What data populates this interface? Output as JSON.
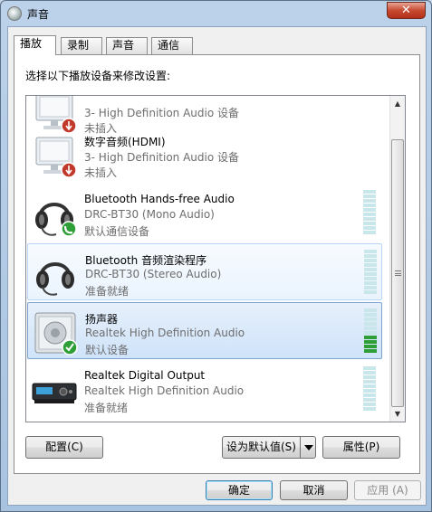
{
  "window": {
    "title": "声音",
    "close_glyph": "✕"
  },
  "tabs": [
    {
      "label": "播放",
      "active": true
    },
    {
      "label": "录制",
      "active": false
    },
    {
      "label": "声音",
      "active": false
    },
    {
      "label": "通信",
      "active": false
    }
  ],
  "instruction": "选择以下播放设备来修改设置:",
  "devices": [
    {
      "icon": "monitor-icon",
      "badge": "unplugged-badge-icon",
      "name": "",
      "desc": "3- High Definition Audio 设备",
      "status": "未插入",
      "level": null
    },
    {
      "icon": "monitor-icon",
      "badge": "unplugged-badge-icon",
      "name": "数字音频(HDMI)",
      "desc": "3- High Definition Audio 设备",
      "status": "未插入",
      "level": null
    },
    {
      "icon": "headset-icon",
      "badge": "phone-badge-icon",
      "name": "Bluetooth Hands-free Audio",
      "desc": "DRC-BT30 (Mono Audio)",
      "status": "默认通信设备",
      "level": 0
    },
    {
      "icon": "headset-icon",
      "badge": "",
      "name": "Bluetooth 音频渲染程序",
      "desc": "DRC-BT30 (Stereo Audio)",
      "status": "准备就绪",
      "level": 0
    },
    {
      "icon": "speaker-icon",
      "badge": "default-check-badge-icon",
      "name": "扬声器",
      "desc": "Realtek High Definition Audio",
      "status": "默认设备",
      "level": 0.4
    },
    {
      "icon": "digital-output-icon",
      "badge": "",
      "name": "Realtek Digital Output",
      "desc": "Realtek High Definition Audio",
      "status": "准备就绪",
      "level": 0
    }
  ],
  "buttons": {
    "configure": "配置(C)",
    "set_default": "设为默认值(S)",
    "properties": "属性(P)",
    "ok": "确定",
    "cancel": "取消",
    "apply": "应用 (A)"
  },
  "colors": {
    "level_on": "#2e9f37",
    "level_off": "#c9e6ea",
    "selection_border": "#7da2ce"
  }
}
